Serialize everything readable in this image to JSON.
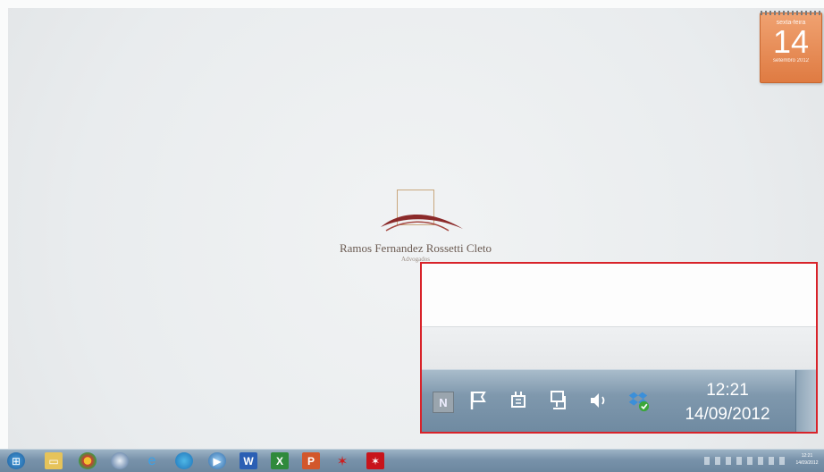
{
  "calendar_gadget": {
    "weekday": "sexta-feira",
    "day": "14",
    "month": "setembro 2012"
  },
  "logo": {
    "name": "Ramos Fernandez Rossetti Cleto",
    "subtitle": "Advogados",
    "colors": {
      "frame": "#c9a77d",
      "swoosh": "#8b2a2a"
    }
  },
  "callout": {
    "border_color": "#d8232a",
    "tray_icons": [
      "notes-icon",
      "action-center-flag-icon",
      "power-icon",
      "network-icon",
      "volume-icon",
      "dropbox-icon"
    ],
    "clock": {
      "time": "12:21",
      "date": "14/09/2012"
    }
  },
  "taskbar": {
    "pinned": [
      "start-orb",
      "windows-explorer",
      "chrome",
      "thunderbird",
      "internet-explorer",
      "app-blue-circle",
      "windows-media-player",
      "word",
      "excel",
      "powerpoint",
      "acrobat",
      "adobe-reader"
    ],
    "clock": {
      "time": "12:21",
      "date": "14/09/2012"
    }
  }
}
